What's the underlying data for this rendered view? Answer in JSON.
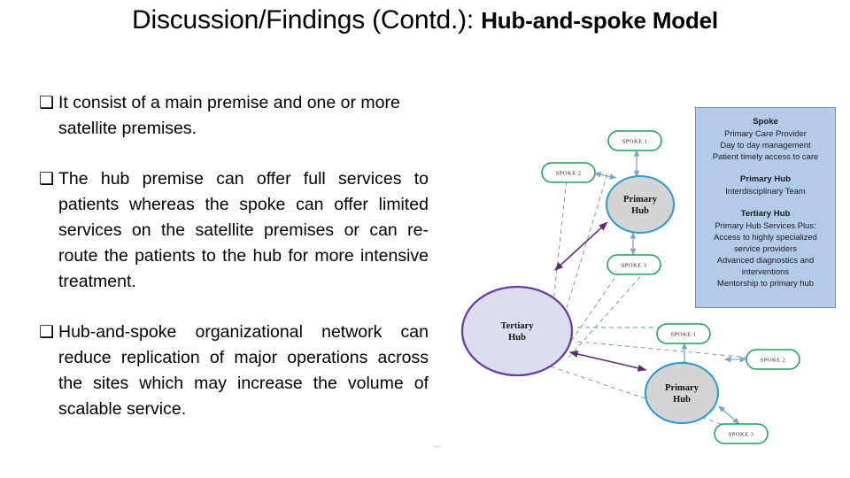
{
  "slide": {
    "title": {
      "regular_part": "Discussion/Findings (Contd.): ",
      "bold_part": "Hub-and-spoke Model"
    },
    "bullets": [
      {
        "marker": "❑",
        "text": "It consist of a main premise and one or more satellite premises.",
        "align": "left"
      },
      {
        "marker": "❑",
        "text": "The hub premise can offer full services to patients whereas the spoke can offer limited services on the satellite premises or can re-route the patients to the hub for more intensive treatment.",
        "align": "justify"
      },
      {
        "marker": "❑",
        "text": "Hub-and-spoke organizational network can reduce replication of major operations across the sites which may increase the volume of scalable service.",
        "align": "justify"
      }
    ]
  },
  "diagram": {
    "clusters": [
      {
        "hub_label_line1": "Primary",
        "hub_label_line2": "Hub",
        "spokes": [
          "SPOKE 1",
          "SPOKE 2",
          "SPOKE 3"
        ]
      },
      {
        "hub_label_line1": "Primary",
        "hub_label_line2": "Hub",
        "spokes": [
          "SPOKE 1",
          "SPOKE 2",
          "SPOKE 3"
        ]
      }
    ],
    "tertiary_hub": {
      "label_line1": "Tertiary",
      "label_line2": "Hub"
    },
    "colors": {
      "spoke_border": "#1d9e58",
      "primary_hub_border": "#2e9bd0",
      "primary_hub_fill": "#d4d4d4",
      "tertiary_hub_border": "#6b3fa0",
      "tertiary_hub_fill": "#dcdef0",
      "dashed_connector": "#6f8fb5",
      "double_arrow": "#7fa3cc",
      "purple_arrow": "#5e2a6e",
      "legend_fill": "#b3cbe8",
      "legend_border": "#6d91b5"
    }
  },
  "legend": {
    "sections": [
      {
        "heading": "Spoke",
        "lines": [
          "Primary Care Provider",
          "Day to day management",
          "Patient timely access to care"
        ]
      },
      {
        "heading": "Primary Hub",
        "lines": [
          "Interdisciplinary Team"
        ]
      },
      {
        "heading": "Tertiary Hub",
        "lines": [
          "Primary Hub Services Plus:",
          "Access to highly specialized",
          "service providers",
          "Advanced diagnostics and",
          "interventions",
          "Mentorship to primary hub"
        ]
      }
    ]
  }
}
